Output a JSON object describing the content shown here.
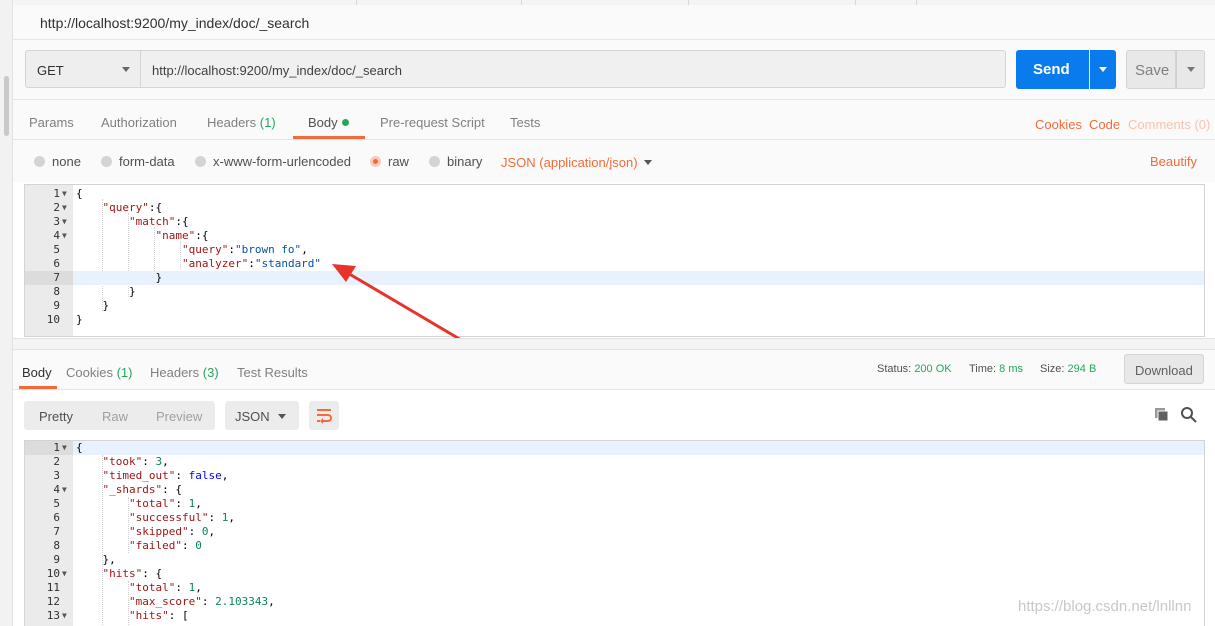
{
  "title": "http://localhost:9200/my_index/doc/_search",
  "request": {
    "method": "GET",
    "url": "http://localhost:9200/my_index/doc/_search",
    "send_label": "Send",
    "save_label": "Save"
  },
  "req_tabs": {
    "params": "Params",
    "authorization": "Authorization",
    "headers": "Headers",
    "headers_count": "(1)",
    "body": "Body",
    "prerequest": "Pre-request Script",
    "tests": "Tests",
    "cookies": "Cookies",
    "code": "Code",
    "comments": "Comments (0)"
  },
  "body_opts": {
    "none": "none",
    "form_data": "form-data",
    "urlencoded": "x-www-form-urlencoded",
    "raw": "raw",
    "binary": "binary",
    "type": "JSON (application/json)",
    "beautify": "Beautify"
  },
  "request_body": [
    {
      "ln": "1",
      "fold": true,
      "text": "{"
    },
    {
      "ln": "2",
      "fold": true,
      "text": "    \"query\":{"
    },
    {
      "ln": "3",
      "fold": true,
      "text": "        \"match\":{"
    },
    {
      "ln": "4",
      "fold": true,
      "text": "            \"name\":{"
    },
    {
      "ln": "5",
      "fold": false,
      "text": "                \"query\":\"brown fo\","
    },
    {
      "ln": "6",
      "fold": false,
      "text": "                \"analyzer\":\"standard\""
    },
    {
      "ln": "7",
      "fold": false,
      "text": "            }"
    },
    {
      "ln": "8",
      "fold": false,
      "text": "        }"
    },
    {
      "ln": "9",
      "fold": false,
      "text": "    }"
    },
    {
      "ln": "10",
      "fold": false,
      "text": "}"
    }
  ],
  "res_tabs": {
    "body": "Body",
    "cookies": "Cookies",
    "cookies_count": "(1)",
    "headers": "Headers",
    "headers_count": "(3)",
    "test_results": "Test Results",
    "status_label": "Status:",
    "status_value": "200 OK",
    "time_label": "Time:",
    "time_value": "8 ms",
    "size_label": "Size:",
    "size_value": "294 B",
    "download": "Download"
  },
  "res_opts": {
    "pretty": "Pretty",
    "raw": "Raw",
    "preview": "Preview",
    "format": "JSON"
  },
  "response_body": [
    {
      "ln": "1",
      "fold": true,
      "text": "{"
    },
    {
      "ln": "2",
      "fold": false,
      "text": "    \"took\": 3,"
    },
    {
      "ln": "3",
      "fold": false,
      "text": "    \"timed_out\": false,"
    },
    {
      "ln": "4",
      "fold": true,
      "text": "    \"_shards\": {"
    },
    {
      "ln": "5",
      "fold": false,
      "text": "        \"total\": 1,"
    },
    {
      "ln": "6",
      "fold": false,
      "text": "        \"successful\": 1,"
    },
    {
      "ln": "7",
      "fold": false,
      "text": "        \"skipped\": 0,"
    },
    {
      "ln": "8",
      "fold": false,
      "text": "        \"failed\": 0"
    },
    {
      "ln": "9",
      "fold": false,
      "text": "    },"
    },
    {
      "ln": "10",
      "fold": true,
      "text": "    \"hits\": {"
    },
    {
      "ln": "11",
      "fold": false,
      "text": "        \"total\": 1,"
    },
    {
      "ln": "12",
      "fold": false,
      "text": "        \"max_score\": 2.103343,"
    },
    {
      "ln": "13",
      "fold": true,
      "text": "        \"hits\": ["
    }
  ],
  "watermark": "https://blog.csdn.net/lnllnn",
  "colors": {
    "accent": "#f26b3a",
    "send": "#097bed",
    "success": "#26a65b"
  }
}
